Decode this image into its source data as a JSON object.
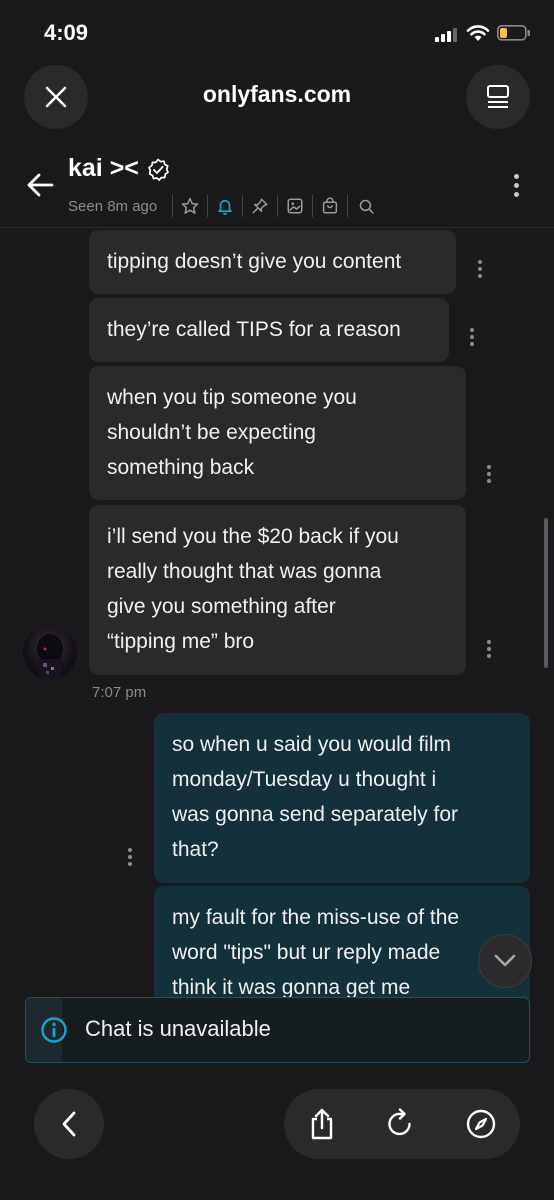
{
  "status_bar": {
    "time": "4:09"
  },
  "browser": {
    "url": "onlyfans.com"
  },
  "chat_header": {
    "name": "kai ><",
    "seen": "Seen 8m ago"
  },
  "messages": {
    "incoming": [
      {
        "lines": [
          "tipping doesn’t give you content"
        ]
      },
      {
        "lines": [
          "they’re called TIPS for a reason"
        ]
      },
      {
        "lines": [
          "when you tip someone you",
          "shouldn’t be expecting",
          "something back"
        ]
      },
      {
        "lines": [
          "i’ll send you the $20 back if you",
          "really thought that was gonna",
          "give you something after",
          "“tipping me” bro"
        ]
      }
    ],
    "timestamp": "7:07 pm",
    "outgoing": [
      {
        "lines": [
          "so when u said you would film",
          "monday/Tuesday u thought i",
          "was gonna send separately for",
          "that?"
        ]
      },
      {
        "lines": [
          "my fault for the miss-use of the",
          "word \"tips\" but ur reply made",
          "think it was gonna get me"
        ]
      }
    ]
  },
  "banner": {
    "text": "Chat is unavailable"
  },
  "icons": {
    "close": "close-icon",
    "reader": "reader-icon",
    "back": "back-arrow-icon",
    "verified": "verified-badge-icon",
    "star": "star-icon",
    "bell": "bell-icon",
    "pin": "pin-icon",
    "image": "image-icon",
    "bag": "shopping-bag-icon",
    "search": "search-icon",
    "more": "more-vertical-icon",
    "chevron": "chevron-down-icon",
    "info": "info-icon",
    "share": "share-icon",
    "reload": "reload-icon",
    "compass": "compass-icon"
  },
  "colors": {
    "accent": "#1da1c4",
    "incoming_bubble": "#2a2a2d",
    "outgoing_bubble": "#14303a",
    "background": "#1a1a1c"
  }
}
